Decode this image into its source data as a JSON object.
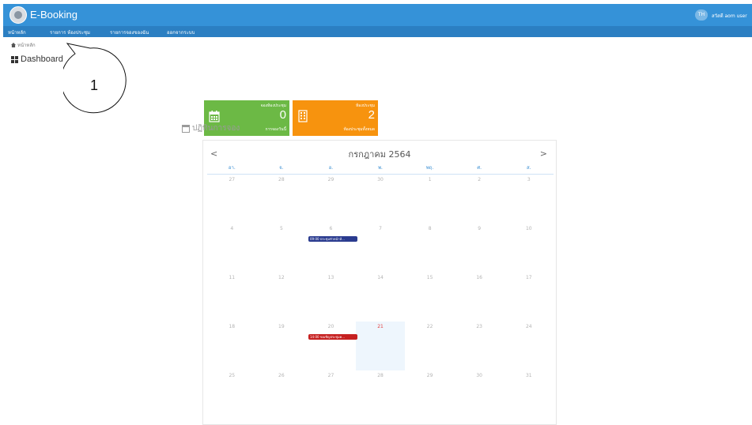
{
  "header": {
    "app_title": "E-Booking",
    "lang_badge": "TH",
    "user_name": "สวัสดี aom user"
  },
  "nav": {
    "items": [
      {
        "label": "หน้าหลัก"
      },
      {
        "label": "รายการ ห้องประชุม"
      },
      {
        "label": "รายการจองของฉัน"
      },
      {
        "label": "ออกจากระบบ"
      }
    ]
  },
  "breadcrumb": {
    "label": "หน้าหลัก"
  },
  "page_title": "Dashboard",
  "callout": {
    "number": "1"
  },
  "stats": [
    {
      "label": "จองห้องประชุม",
      "value": "0",
      "sub": "การจองวันนี้",
      "color": "#6cb945",
      "icon": "calendar-icon"
    },
    {
      "label": "ห้องประชุม",
      "value": "2",
      "sub": "ห้องประชุมทั้งหมด",
      "color": "#f7930e",
      "icon": "building-icon"
    }
  ],
  "calendar": {
    "section_title": "ปฏิทินการจอง",
    "prev": "<",
    "next": ">",
    "month_label": "กรกฎาคม 2564",
    "weekdays": [
      "อา.",
      "จ.",
      "อ.",
      "พ.",
      "พฤ.",
      "ศ.",
      "ส."
    ],
    "weeks": [
      [
        "27",
        "28",
        "29",
        "30",
        "1",
        "2",
        "3"
      ],
      [
        "4",
        "5",
        "6",
        "7",
        "8",
        "9",
        "10"
      ],
      [
        "11",
        "12",
        "13",
        "14",
        "15",
        "16",
        "17"
      ],
      [
        "18",
        "19",
        "20",
        "21",
        "22",
        "23",
        "24"
      ],
      [
        "25",
        "26",
        "27",
        "28",
        "29",
        "30",
        "31"
      ]
    ],
    "today": "21",
    "events": [
      {
        "text": "09:00 ประชุมหัวหน้าห้...",
        "color": "#2a3b8f"
      },
      {
        "text": "14:00 ขอเชิญประชุมค...",
        "color": "#c62020"
      }
    ]
  }
}
